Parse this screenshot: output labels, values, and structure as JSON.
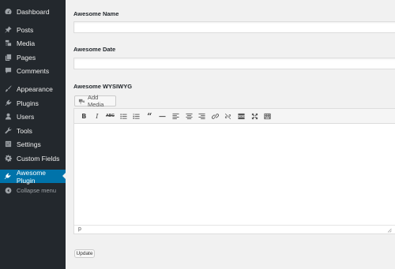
{
  "sidebar": {
    "items": [
      {
        "label": "Dashboard",
        "icon": "dashboard-icon"
      },
      {
        "label": "Posts",
        "icon": "pushpin-icon"
      },
      {
        "label": "Media",
        "icon": "media-icon"
      },
      {
        "label": "Pages",
        "icon": "pages-icon"
      },
      {
        "label": "Comments",
        "icon": "comment-icon"
      },
      {
        "label": "Appearance",
        "icon": "brush-icon"
      },
      {
        "label": "Plugins",
        "icon": "plugin-icon"
      },
      {
        "label": "Users",
        "icon": "user-icon"
      },
      {
        "label": "Tools",
        "icon": "wrench-icon"
      },
      {
        "label": "Settings",
        "icon": "settings-icon"
      },
      {
        "label": "Custom Fields",
        "icon": "gear-icon"
      },
      {
        "label": "Awesome Plugin",
        "icon": "plugin-icon"
      }
    ],
    "collapse_label": "Collapse menu",
    "active_color": "#0073aa",
    "background": "#23282d"
  },
  "form": {
    "name_label": "Awesome Name",
    "name_value": "",
    "date_label": "Awesome Date",
    "date_value": "",
    "wysiwyg_label": "Awesome WYSIWYG",
    "add_media_label": "Add Media",
    "editor_path": "p",
    "update_label": "Update"
  },
  "toolbar": {
    "buttons": [
      "bold-icon",
      "italic-icon",
      "strikethrough-icon",
      "bullet-list-icon",
      "numbered-list-icon",
      "blockquote-icon",
      "horizontal-rule-icon",
      "align-left-icon",
      "align-center-icon",
      "align-right-icon",
      "link-icon",
      "unlink-icon",
      "read-more-icon",
      "fullscreen-icon",
      "toolbar-toggle-icon"
    ]
  }
}
